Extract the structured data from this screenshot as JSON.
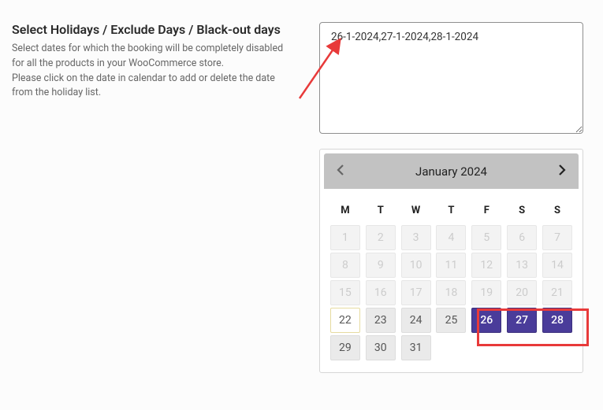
{
  "left": {
    "title": "Select Holidays / Exclude Days / Black-out days",
    "desc1": "Select dates for which the booking will be completely disabled for all the products in your WooCommerce store.",
    "desc2": "Please click on the date in calendar to add or delete the date from the holiday list."
  },
  "textarea_value": "26-1-2024,27-1-2024,28-1-2024",
  "calendar": {
    "month_label": "January 2024",
    "weekdays": [
      "M",
      "T",
      "W",
      "T",
      "F",
      "S",
      "S"
    ],
    "weeks": [
      [
        {
          "n": 1,
          "state": "dis"
        },
        {
          "n": 2,
          "state": "dis"
        },
        {
          "n": 3,
          "state": "dis"
        },
        {
          "n": 4,
          "state": "dis"
        },
        {
          "n": 5,
          "state": "dis"
        },
        {
          "n": 6,
          "state": "dis"
        },
        {
          "n": 7,
          "state": "dis"
        }
      ],
      [
        {
          "n": 8,
          "state": "dis"
        },
        {
          "n": 9,
          "state": "dis"
        },
        {
          "n": 10,
          "state": "dis"
        },
        {
          "n": 11,
          "state": "dis"
        },
        {
          "n": 12,
          "state": "dis"
        },
        {
          "n": 13,
          "state": "dis"
        },
        {
          "n": 14,
          "state": "dis"
        }
      ],
      [
        {
          "n": 15,
          "state": "dis"
        },
        {
          "n": 16,
          "state": "dis"
        },
        {
          "n": 17,
          "state": "dis"
        },
        {
          "n": 18,
          "state": "dis"
        },
        {
          "n": 19,
          "state": "dis"
        },
        {
          "n": 20,
          "state": "dis"
        },
        {
          "n": 21,
          "state": "dis"
        }
      ],
      [
        {
          "n": 22,
          "state": "today"
        },
        {
          "n": 23,
          "state": "en"
        },
        {
          "n": 24,
          "state": "en"
        },
        {
          "n": 25,
          "state": "en"
        },
        {
          "n": 26,
          "state": "sel"
        },
        {
          "n": 27,
          "state": "sel"
        },
        {
          "n": 28,
          "state": "sel"
        }
      ],
      [
        {
          "n": 29,
          "state": "en"
        },
        {
          "n": 30,
          "state": "en"
        },
        {
          "n": 31,
          "state": "en"
        },
        null,
        null,
        null,
        null
      ]
    ]
  }
}
